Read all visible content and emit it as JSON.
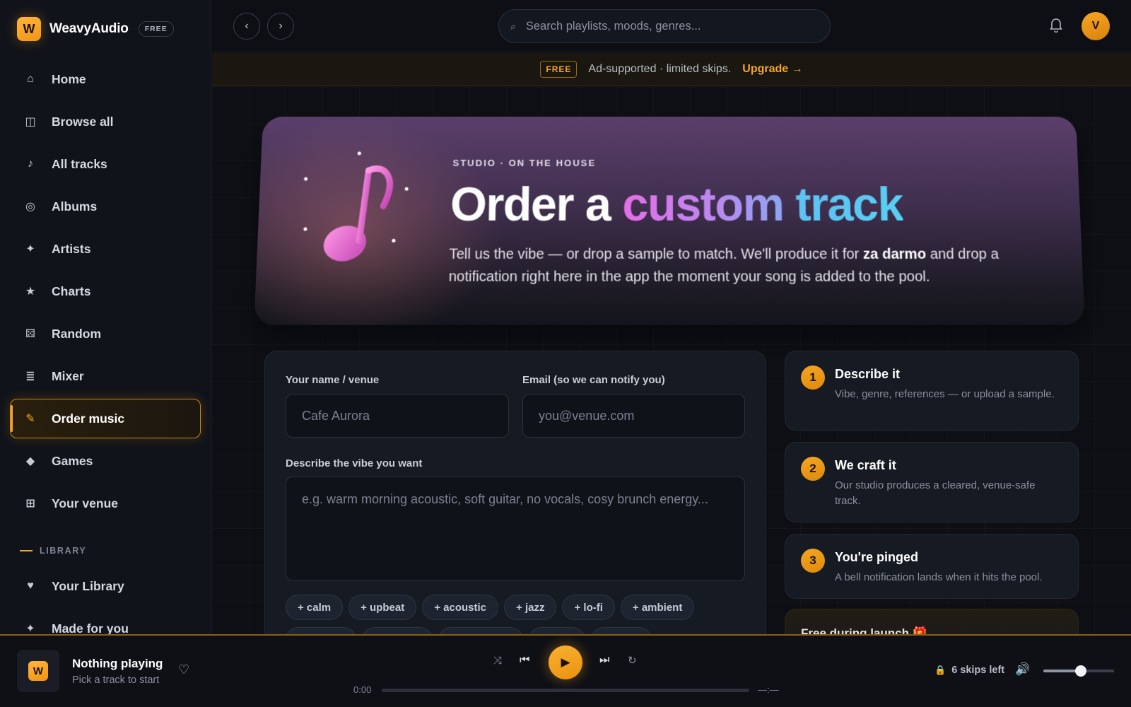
{
  "brand": {
    "logo_letter": "W",
    "name": "WeavyAudio",
    "badge": "FREE"
  },
  "sidebar": {
    "items": [
      {
        "label": "Home",
        "icon": "home-icon",
        "glyph": "⌂"
      },
      {
        "label": "Browse all",
        "icon": "browse-icon",
        "glyph": "◫"
      },
      {
        "label": "All tracks",
        "icon": "note-icon",
        "glyph": "♪"
      },
      {
        "label": "Albums",
        "icon": "disc-icon",
        "glyph": "◎"
      },
      {
        "label": "Artists",
        "icon": "sparkle-icon",
        "glyph": "✦"
      },
      {
        "label": "Charts",
        "icon": "star-icon",
        "glyph": "★"
      },
      {
        "label": "Random",
        "icon": "dice-icon",
        "glyph": "⚄"
      },
      {
        "label": "Mixer",
        "icon": "sliders-icon",
        "glyph": "≣"
      },
      {
        "label": "Order music",
        "icon": "pencil-icon",
        "glyph": "✎",
        "active": true
      },
      {
        "label": "Games",
        "icon": "diamond-icon",
        "glyph": "◆"
      },
      {
        "label": "Your venue",
        "icon": "grid-icon",
        "glyph": "⊞"
      }
    ],
    "library_label": "LIBRARY",
    "library_items": [
      {
        "label": "Your Library",
        "icon": "heart-icon",
        "glyph": "♥"
      },
      {
        "label": "Made for you",
        "icon": "sparkle-icon",
        "glyph": "✦"
      }
    ]
  },
  "topbar": {
    "back_glyph": "‹",
    "forward_glyph": "›",
    "search_placeholder": "Search playlists, moods, genres...",
    "search_icon_glyph": "⌕",
    "bell_glyph": "🔔",
    "avatar_letter": "V"
  },
  "banner": {
    "tag": "FREE",
    "text": "Ad-supported · limited skips.",
    "upgrade": "Upgrade →"
  },
  "hero": {
    "kicker": "STUDIO · ON THE HOUSE",
    "title_w1": "Order a ",
    "title_w2": "custom",
    "title_w3": " track",
    "desc_pre": "Tell us the vibe — or drop a sample to match. We'll produce it for ",
    "desc_bold": "za darmo",
    "desc_post": " and drop a notification right here in the app the moment your song is added to the pool."
  },
  "form": {
    "name_label": "Your name / venue",
    "name_placeholder": "Cafe Aurora",
    "email_label": "Email (so we can notify you)",
    "email_placeholder": "you@venue.com",
    "vibe_label": "Describe the vibe you want",
    "vibe_placeholder": "e.g. warm morning acoustic, soft guitar, no vocals, cosy brunch energy...",
    "chips": [
      "+ calm",
      "+ upbeat",
      "+ acoustic",
      "+ jazz",
      "+ lo-fi",
      "+ ambient"
    ]
  },
  "steps": [
    {
      "num": "1",
      "title": "Describe it",
      "body": "Vibe, genre, references — or upload a sample."
    },
    {
      "num": "2",
      "title": "We craft it",
      "body": "Our studio produces a cleared, venue-safe track."
    },
    {
      "num": "3",
      "title": "You're pinged",
      "body": "A bell notification lands when it hits the pool."
    }
  ],
  "launch": {
    "title": "Free during launch 🎁"
  },
  "player": {
    "art_letter": "W",
    "title": "Nothing playing",
    "subtitle": "Pick a track to start",
    "heart_glyph": "♡",
    "shuffle_glyph": "⤨",
    "prev_glyph": "⏮",
    "play_glyph": "▶",
    "next_glyph": "⏭",
    "repeat_glyph": "↻",
    "time_current": "0:00",
    "time_total": "—:—",
    "progress": 0,
    "skips": "6 skips left",
    "lock_glyph": "🔒",
    "volume_glyph": "🔊",
    "volume": 0.53
  },
  "colors": {
    "accent": "#f6a623",
    "background": "#0b0d12",
    "panel": "#161a22"
  }
}
